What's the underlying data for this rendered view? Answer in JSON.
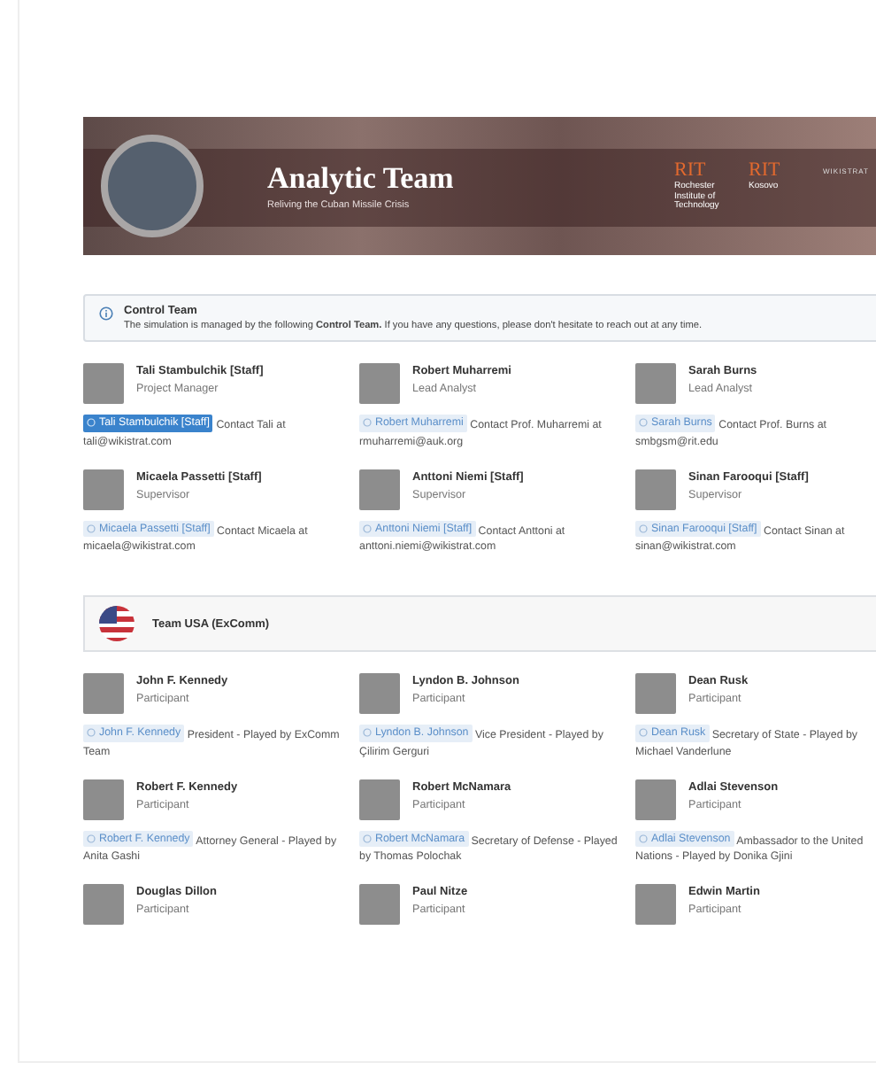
{
  "banner": {
    "title": "Analytic Team",
    "subtitle": "Reliving the Cuban Missile Crisis",
    "logos": [
      {
        "kind": "rit",
        "mark": "RIT",
        "caption": "Rochester Institute of Technology"
      },
      {
        "kind": "rit",
        "mark": "RIT",
        "caption": "Kosovo"
      },
      {
        "kind": "wordmark",
        "mark": "WIKISTRAT"
      }
    ]
  },
  "control_team": {
    "title": "Control Team",
    "message": "The simulation is managed by the following **Control Team.** If you have any questions, please don't hesitate to reach out at any time.",
    "members": [
      {
        "name": "Tali Stambulchik [Staff]",
        "role": "Project Manager",
        "mention": {
          "label": "Tali Stambulchik [Staff]",
          "selected": true
        },
        "note": "Contact Tali at tali@wikistrat.com"
      },
      {
        "name": "Robert Muharremi",
        "role": "Lead Analyst",
        "mention": {
          "label": "Robert Muharremi",
          "selected": false
        },
        "note": "Contact Prof. Muharremi at rmuharremi@auk.org"
      },
      {
        "name": "Sarah Burns",
        "role": "Lead Analyst",
        "mention": {
          "label": "Sarah Burns",
          "selected": false
        },
        "note": "Contact Prof. Burns at smbgsm@rit.edu"
      },
      {
        "name": "Micaela Passetti [Staff]",
        "role": "Supervisor",
        "mention": {
          "label": "Micaela Passetti [Staff]",
          "selected": false
        },
        "note": "Contact Micaela at micaela@wikistrat.com"
      },
      {
        "name": "Anttoni Niemi [Staff]",
        "role": "Supervisor",
        "mention": {
          "label": "Anttoni Niemi [Staff]",
          "selected": false
        },
        "note": "Contact Anttoni at anttoni.niemi@wikistrat.com"
      },
      {
        "name": "Sinan Farooqui [Staff]",
        "role": "Supervisor",
        "mention": {
          "label": "Sinan Farooqui [Staff]",
          "selected": false
        },
        "note": "Contact Sinan at sinan@wikistrat.com"
      }
    ]
  },
  "teams": [
    {
      "name": "Team USA (ExComm)",
      "members": [
        {
          "name": "John F. Kennedy",
          "role": "Participant",
          "mention": {
            "label": "John F. Kennedy",
            "selected": false
          },
          "note": "President - Played by ExComm Team"
        },
        {
          "name": "Lyndon B. Johnson",
          "role": "Participant",
          "mention": {
            "label": "Lyndon B. Johnson",
            "selected": false
          },
          "note": "Vice President - Played by Çilirim Gerguri"
        },
        {
          "name": "Dean Rusk",
          "role": "Participant",
          "mention": {
            "label": "Dean Rusk",
            "selected": false
          },
          "note": "Secretary of State - Played by Michael Vanderlune"
        },
        {
          "name": "Robert F. Kennedy",
          "role": "Participant",
          "mention": {
            "label": "Robert F. Kennedy",
            "selected": false
          },
          "note": "Attorney General - Played by Anita Gashi"
        },
        {
          "name": "Robert McNamara",
          "role": "Participant",
          "mention": {
            "label": "Robert McNamara",
            "selected": false
          },
          "note": "Secretary of Defense - Played by Thomas Polochak"
        },
        {
          "name": "Adlai Stevenson",
          "role": "Participant",
          "mention": {
            "label": "Adlai Stevenson",
            "selected": false
          },
          "note": "Ambassador to the United Nations - Played by Donika Gjini"
        },
        {
          "name": "Douglas Dillon",
          "role": "Participant"
        },
        {
          "name": "Paul Nitze",
          "role": "Participant"
        },
        {
          "name": "Edwin Martin",
          "role": "Participant"
        }
      ]
    }
  ]
}
